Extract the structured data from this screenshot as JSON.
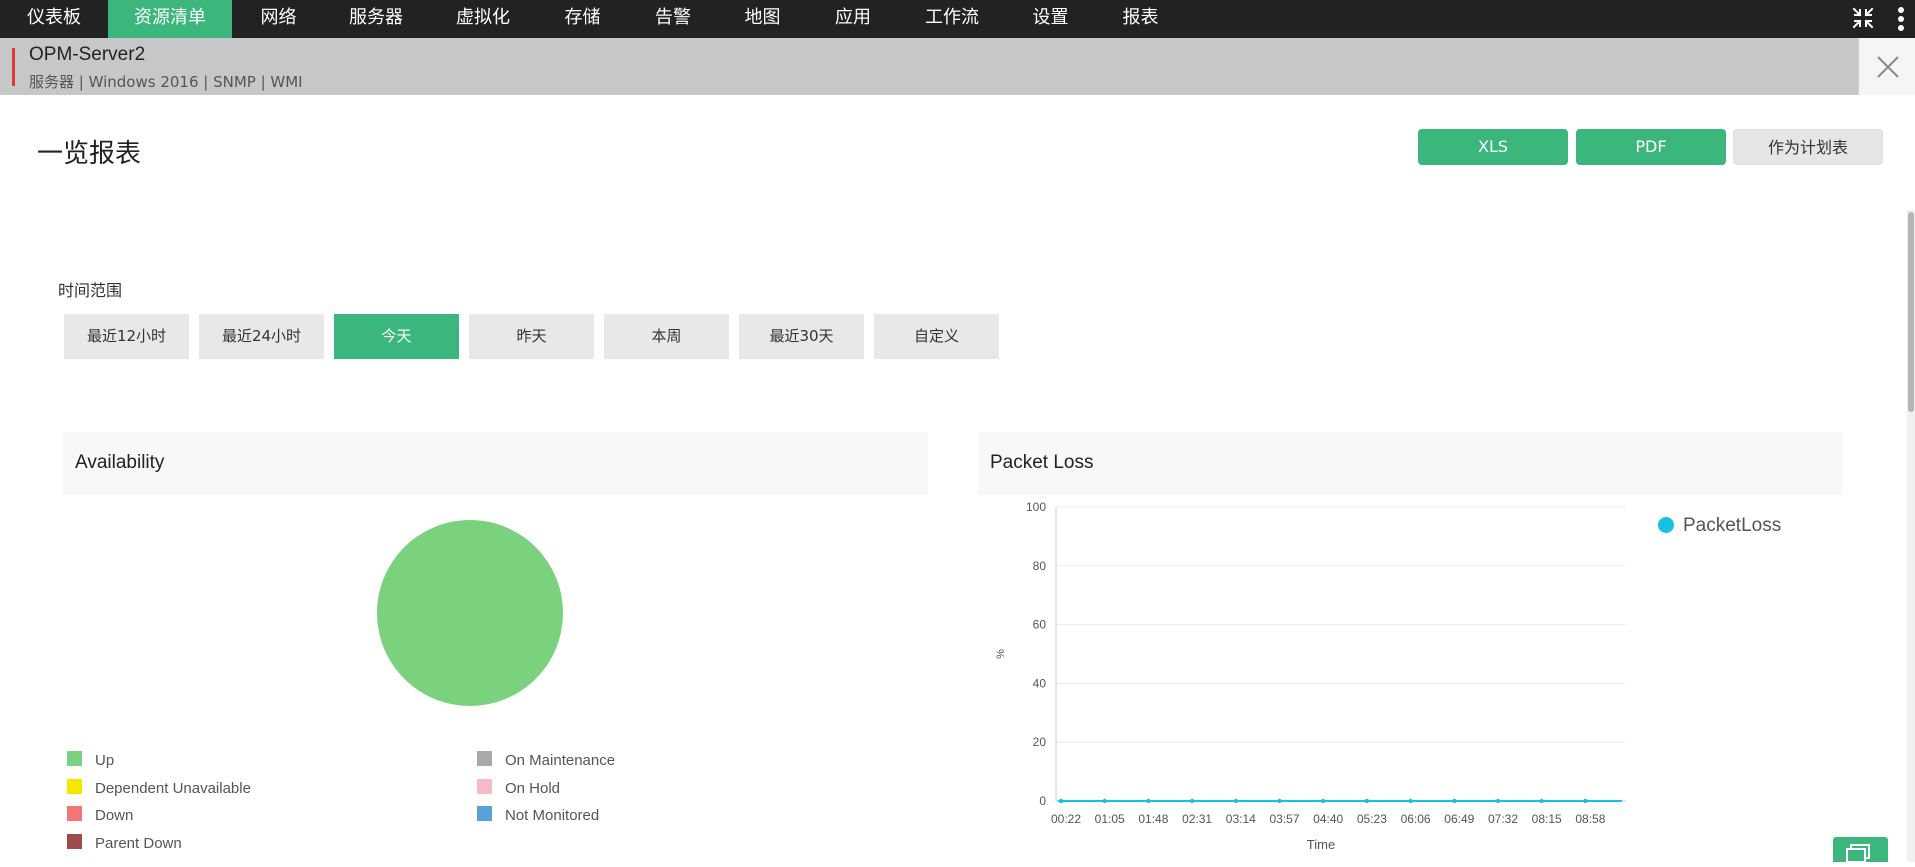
{
  "nav": {
    "items": [
      "仪表板",
      "资源清单",
      "网络",
      "服务器",
      "虚拟化",
      "存储",
      "告警",
      "地图",
      "应用",
      "工作流",
      "设置",
      "报表"
    ],
    "active_index": 1
  },
  "header": {
    "server_name": "OPM-Server2",
    "meta": "服务器 | Windows 2016  | SNMP  | WMI"
  },
  "page": {
    "title": "一览报表",
    "buttons": {
      "xls": "XLS",
      "pdf": "PDF",
      "schedule": "作为计划表"
    }
  },
  "time_range": {
    "label": "时间范围",
    "options": [
      "最近12小时",
      "最近24小时",
      "今天",
      "昨天",
      "本周",
      "最近30天",
      "自定义"
    ],
    "active_index": 2
  },
  "availability": {
    "title": "Availability",
    "legend": [
      {
        "label": "Up",
        "color": "#7ad27f"
      },
      {
        "label": "Dependent Unavailable",
        "color": "#f6e600"
      },
      {
        "label": "Down",
        "color": "#f47676"
      },
      {
        "label": "Parent Down",
        "color": "#a04b4b"
      },
      {
        "label": "On Maintenance",
        "color": "#a9a9a9"
      },
      {
        "label": "On Hold",
        "color": "#f8bac6"
      },
      {
        "label": "Not Monitored",
        "color": "#5aa0d8"
      }
    ]
  },
  "packet_loss": {
    "title": "Packet Loss"
  },
  "chart_data": [
    {
      "type": "pie",
      "title": "Availability",
      "labels": [
        "Up"
      ],
      "values": [
        100
      ],
      "colors": [
        "#7ad27f"
      ]
    },
    {
      "type": "line",
      "title": "Packet Loss",
      "xlabel": "Time",
      "ylabel": "%",
      "ylim": [
        0,
        100
      ],
      "yticks": [
        0,
        20,
        40,
        60,
        80,
        100
      ],
      "x": [
        "00:22",
        "01:05",
        "01:48",
        "02:31",
        "03:14",
        "03:57",
        "04:40",
        "05:23",
        "06:06",
        "06:49",
        "07:32",
        "08:15",
        "08:58"
      ],
      "series": [
        {
          "name": "PacketLoss",
          "values": [
            0,
            0,
            0,
            0,
            0,
            0,
            0,
            0,
            0,
            0,
            0,
            0,
            0
          ],
          "color": "#17c1e0"
        }
      ],
      "legend": "top-right",
      "grid": true
    }
  ]
}
